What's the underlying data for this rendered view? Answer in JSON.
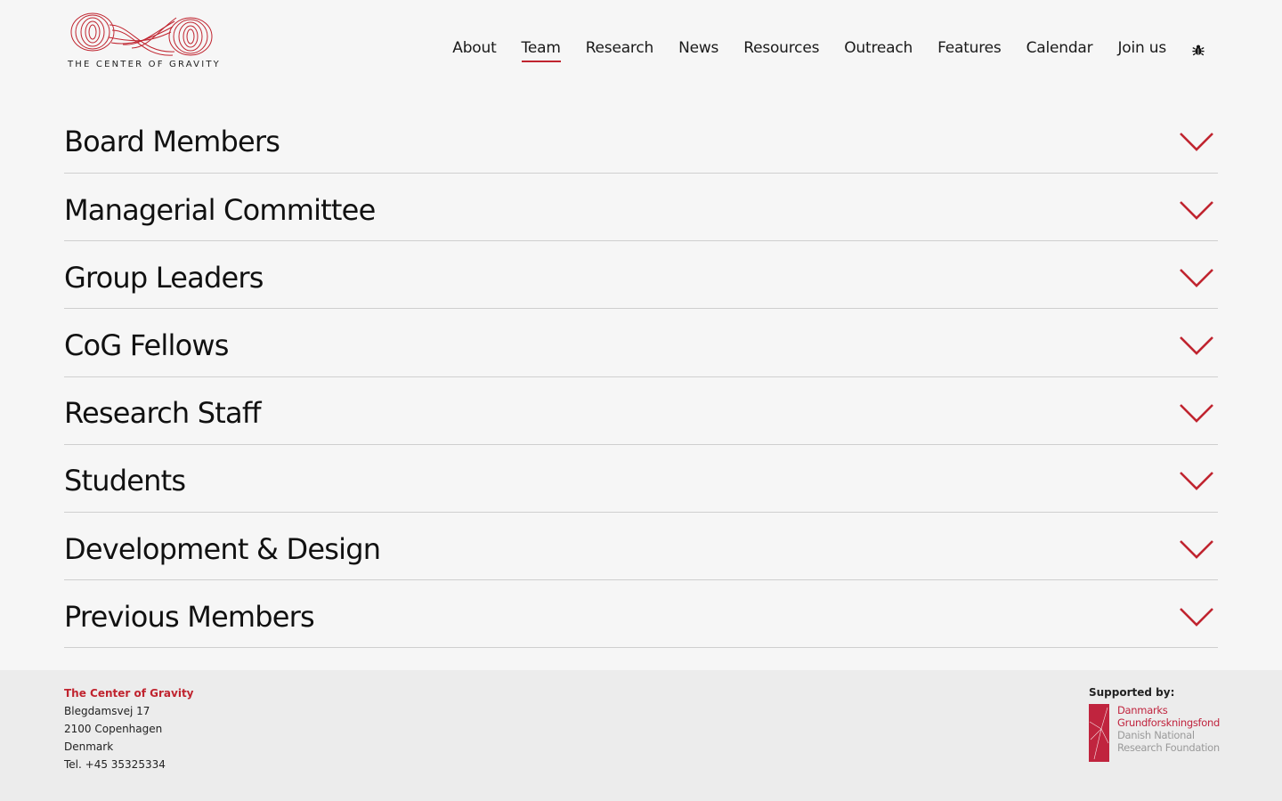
{
  "brand": {
    "name": "THE CENTER OF GRAVITY",
    "accent_color": "#c0242f",
    "logo_icon": "spiral-wave-logo"
  },
  "nav": {
    "items": [
      {
        "label": "About",
        "active": false
      },
      {
        "label": "Team",
        "active": true
      },
      {
        "label": "Research",
        "active": false
      },
      {
        "label": "News",
        "active": false
      },
      {
        "label": "Resources",
        "active": false
      },
      {
        "label": "Outreach",
        "active": false
      },
      {
        "label": "Features",
        "active": false
      },
      {
        "label": "Calendar",
        "active": false
      },
      {
        "label": "Join us",
        "active": false
      }
    ],
    "extra_icon": "bug-icon"
  },
  "accordion": {
    "toggle_icon": "chevron-down-icon",
    "sections": [
      {
        "title": "Board Members"
      },
      {
        "title": "Managerial Committee"
      },
      {
        "title": "Group Leaders"
      },
      {
        "title": "CoG Fellows"
      },
      {
        "title": "Research Staff"
      },
      {
        "title": "Students"
      },
      {
        "title": "Development & Design"
      },
      {
        "title": "Previous Members"
      }
    ]
  },
  "footer": {
    "org_name": "The Center of Gravity",
    "address_line1": "Blegdamsvej 17",
    "address_line2": "2100 Copenhagen",
    "country": "Denmark",
    "phone": "Tel. +45 35325334",
    "supported_label": "Supported by:",
    "sponsor": {
      "line1": "Danmarks",
      "line2": "Grundforskningsfond",
      "line3": "Danish National",
      "line4": "Research Foundation",
      "color": "#c0243e"
    }
  }
}
